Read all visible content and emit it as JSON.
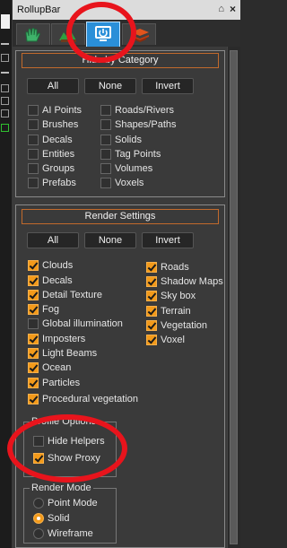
{
  "window": {
    "title": "RollupBar",
    "pin_glyph": "⌂",
    "close_glyph": "×"
  },
  "tabs": [
    {
      "name": "objects",
      "icon": "hand-icon",
      "active": false
    },
    {
      "name": "terrain",
      "icon": "terrain-icon",
      "active": false
    },
    {
      "name": "display",
      "icon": "display-icon",
      "active": true
    },
    {
      "name": "layers",
      "icon": "layers-icon",
      "active": false
    }
  ],
  "hide_by_category": {
    "title": "Hide by Category",
    "buttons": {
      "all": "All",
      "none": "None",
      "invert": "Invert"
    },
    "items": [
      {
        "label": "AI Points",
        "checked": false
      },
      {
        "label": "Brushes",
        "checked": false
      },
      {
        "label": "Decals",
        "checked": false
      },
      {
        "label": "Entities",
        "checked": false
      },
      {
        "label": "Groups",
        "checked": false
      },
      {
        "label": "Prefabs",
        "checked": false
      },
      {
        "label": "Roads/Rivers",
        "checked": false
      },
      {
        "label": "Shapes/Paths",
        "checked": false
      },
      {
        "label": "Solids",
        "checked": false
      },
      {
        "label": "Tag Points",
        "checked": false
      },
      {
        "label": "Volumes",
        "checked": false
      },
      {
        "label": "Voxels",
        "checked": false
      }
    ]
  },
  "render_settings": {
    "title": "Render Settings",
    "buttons": {
      "all": "All",
      "none": "None",
      "invert": "Invert"
    },
    "items": [
      {
        "label": "Clouds",
        "checked": true
      },
      {
        "label": "Decals",
        "checked": true
      },
      {
        "label": "Detail Texture",
        "checked": true
      },
      {
        "label": "Fog",
        "checked": true
      },
      {
        "label": "Global illumination",
        "checked": false
      },
      {
        "label": "Imposters",
        "checked": true
      },
      {
        "label": "Light Beams",
        "checked": true
      },
      {
        "label": "Ocean",
        "checked": true
      },
      {
        "label": "Particles",
        "checked": true
      },
      {
        "label": "Procedural vegetation",
        "checked": true
      },
      {
        "label": "Roads",
        "checked": true
      },
      {
        "label": "Shadow Maps",
        "checked": true
      },
      {
        "label": "Sky box",
        "checked": true
      },
      {
        "label": "Terrain",
        "checked": true
      },
      {
        "label": "Vegetation",
        "checked": true
      },
      {
        "label": "Voxel",
        "checked": true
      }
    ]
  },
  "profile_options": {
    "title": "Profile Options",
    "items": [
      {
        "label": "Hide Helpers",
        "checked": false
      },
      {
        "label": "Show Proxy",
        "checked": true
      }
    ]
  },
  "render_mode": {
    "title": "Render Mode",
    "options": [
      {
        "label": "Point Mode",
        "selected": false
      },
      {
        "label": "Solid",
        "selected": true
      },
      {
        "label": "Wireframe",
        "selected": false
      }
    ]
  },
  "colors": {
    "accent": "#f39a1a",
    "active_tab": "#2a8fd8",
    "highlight_ring": "#e8141c",
    "panel_header_border": "#c26a2c"
  }
}
